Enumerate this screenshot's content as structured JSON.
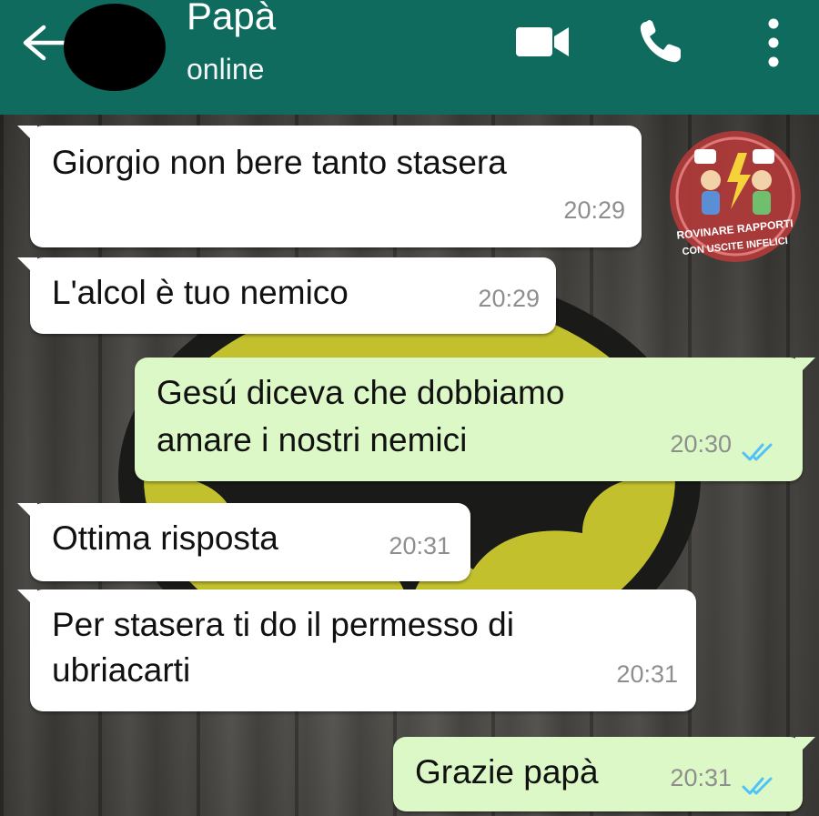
{
  "header": {
    "contact_name": "Papà",
    "status": "online",
    "colors": {
      "bar": "#0f6b5e",
      "icon": "#ffffff"
    }
  },
  "watermark": {
    "line1": "ROVINARE RAPPORTI",
    "line2": "CON USCITE INFELICI"
  },
  "messages": [
    {
      "direction": "in",
      "lines": [
        "Giorgio non bere tanto stasera"
      ],
      "time": "20:29"
    },
    {
      "direction": "in",
      "lines": [
        "L'alcol è tuo nemico"
      ],
      "time": "20:29"
    },
    {
      "direction": "out",
      "lines": [
        "Gesú diceva che dobbiamo",
        "amare i nostri nemici"
      ],
      "time": "20:30",
      "read": true
    },
    {
      "direction": "in",
      "lines": [
        "Ottima risposta"
      ],
      "time": "20:31"
    },
    {
      "direction": "in",
      "lines": [
        "Per stasera ti do il permesso di",
        "ubriacarti"
      ],
      "time": "20:31"
    },
    {
      "direction": "out",
      "lines": [
        "Grazie papà"
      ],
      "time": "20:31",
      "read": true
    }
  ],
  "colors": {
    "incoming_bubble": "#ffffff",
    "outgoing_bubble": "#dcf8c6",
    "read_ticks": "#4fc3f7"
  }
}
